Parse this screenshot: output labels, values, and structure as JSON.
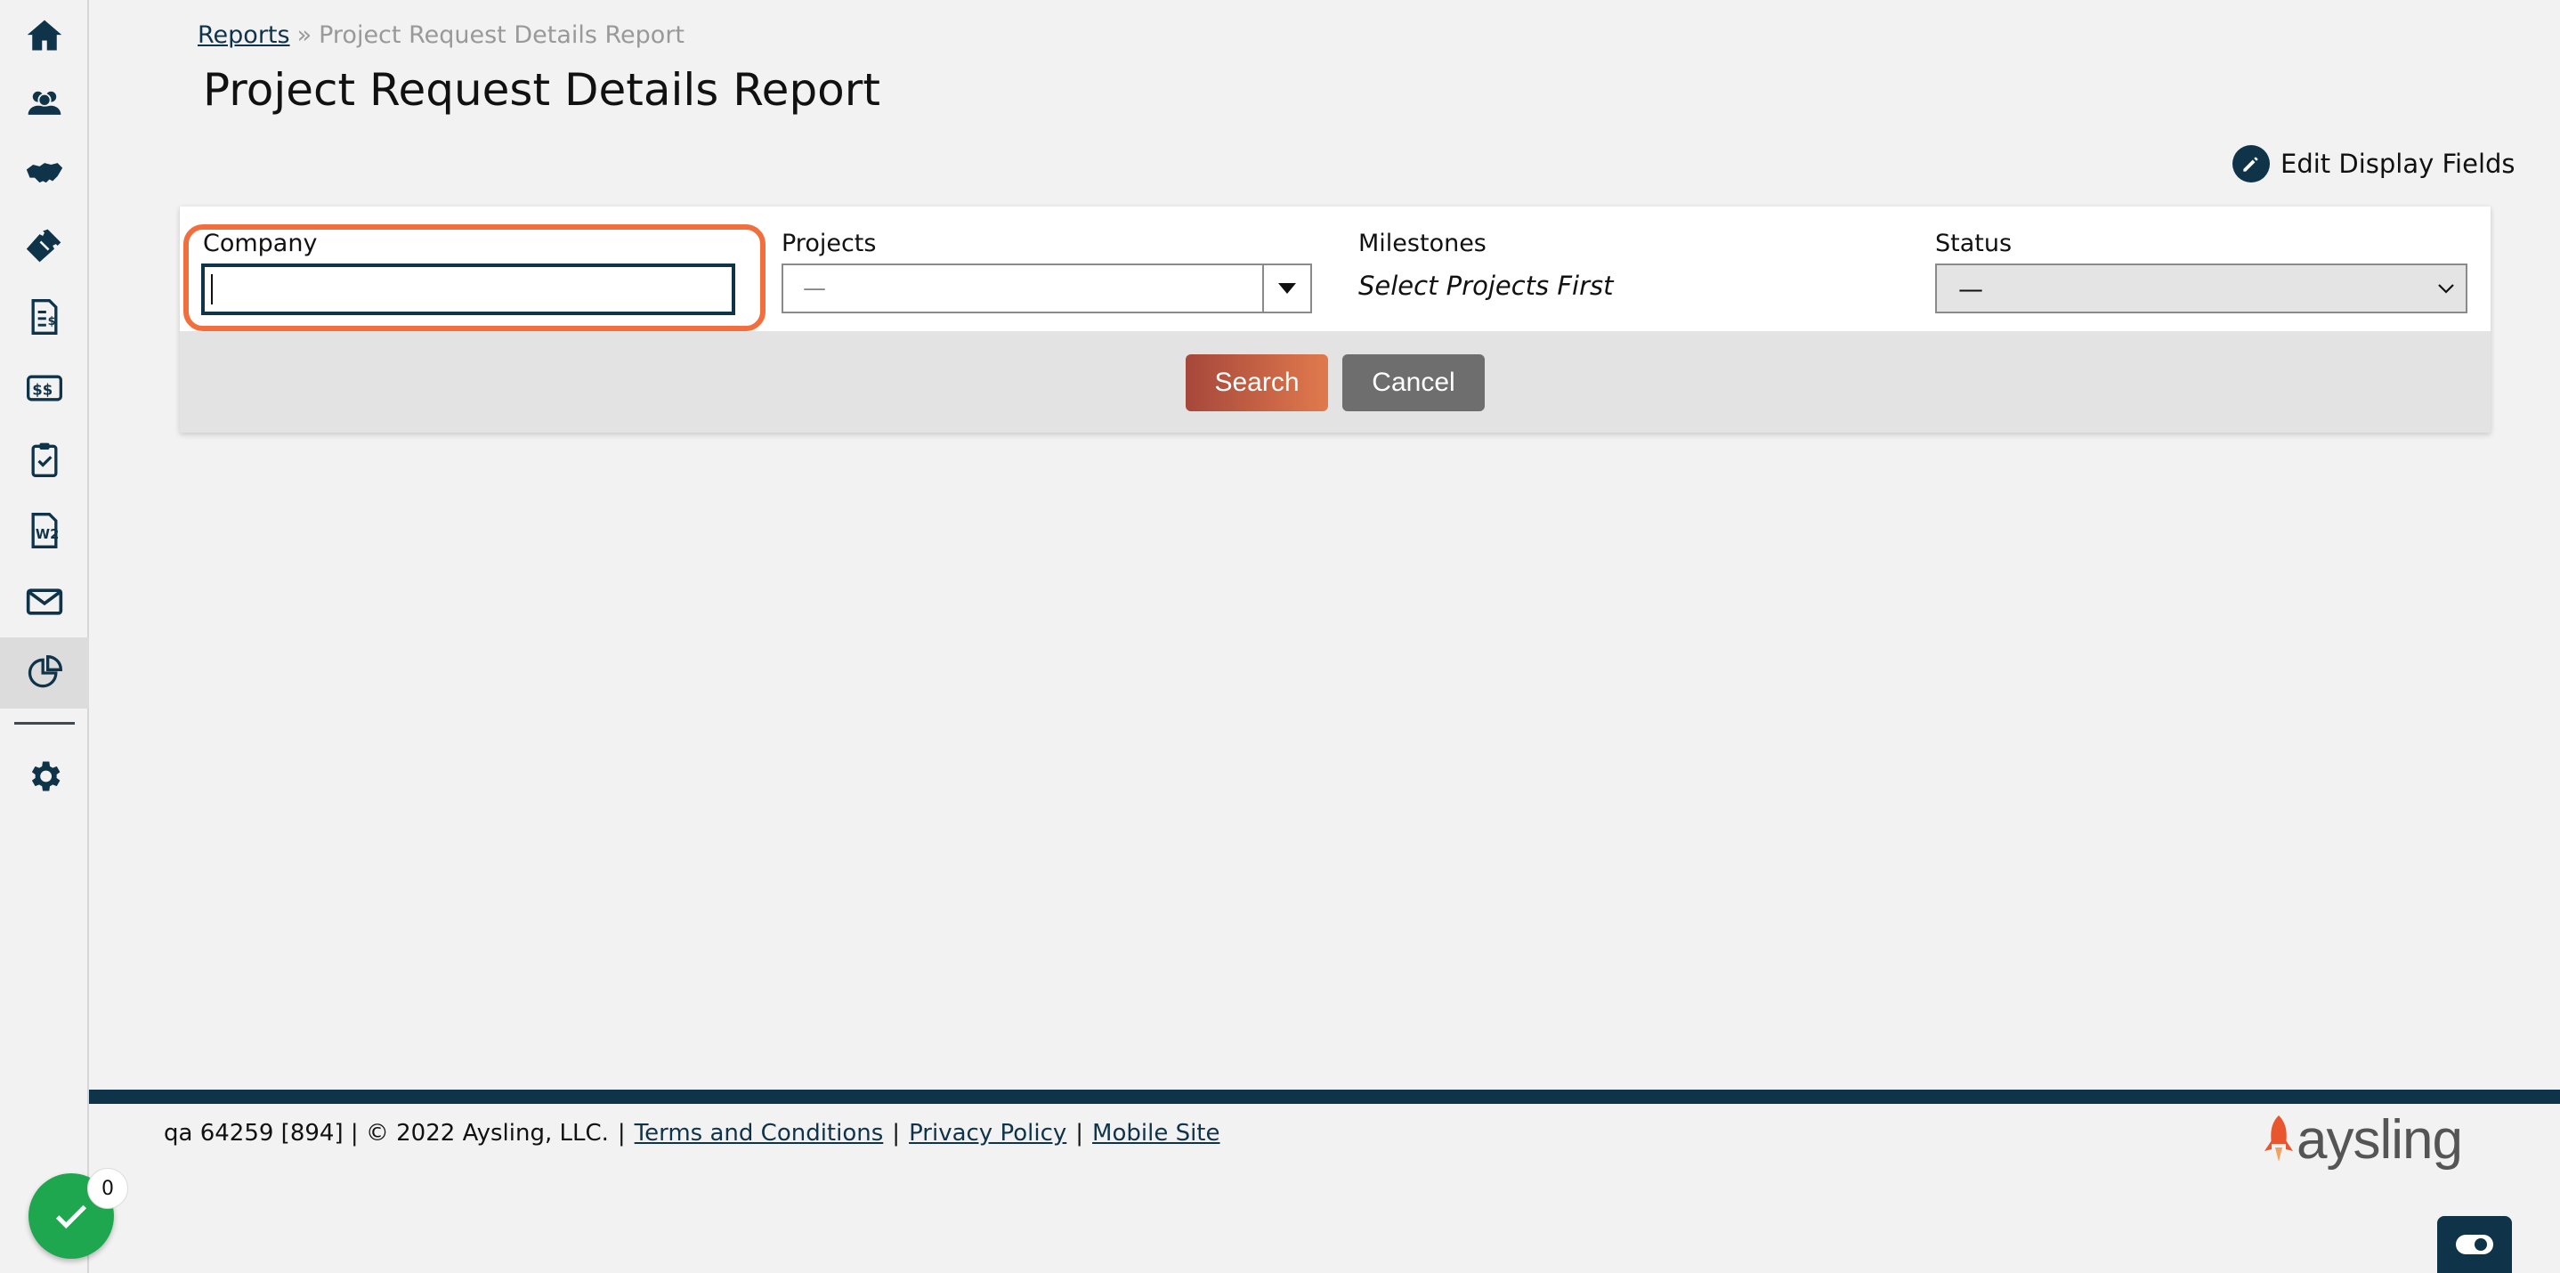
{
  "breadcrumb": {
    "parent": "Reports",
    "separator": "»",
    "current": "Project Request Details Report"
  },
  "page": {
    "title": "Project Request Details Report"
  },
  "toolbar": {
    "edit_fields_label": "Edit Display Fields"
  },
  "filters": {
    "company": {
      "label": "Company",
      "value": ""
    },
    "projects": {
      "label": "Projects",
      "value": "—"
    },
    "milestones": {
      "label": "Milestones",
      "hint": "Select Projects First"
    },
    "status": {
      "label": "Status",
      "value": "—"
    }
  },
  "actions": {
    "search_label": "Search",
    "cancel_label": "Cancel"
  },
  "footer": {
    "info": "qa 64259 [894] | © 2022 Aysling, LLC.",
    "terms": "Terms and Conditions",
    "privacy": "Privacy Policy",
    "mobile": "Mobile Site",
    "pipe": "|",
    "logo_text": "aysling"
  },
  "widgets": {
    "task_count": "0"
  },
  "colors": {
    "primary": "#0f3349",
    "highlight": "#f26f3d",
    "search_start": "#a6473b",
    "search_end": "#e07a4d",
    "cancel": "#6e6e6e",
    "fab": "#1fa74f",
    "logo_rocket": "#e8552e"
  },
  "sidebar": {
    "items": [
      {
        "icon": "home-icon"
      },
      {
        "icon": "users-icon"
      },
      {
        "icon": "handshake-icon"
      },
      {
        "icon": "ticket-icon"
      },
      {
        "icon": "invoice-icon"
      },
      {
        "icon": "money-icon"
      },
      {
        "icon": "clipboard-check-icon"
      },
      {
        "icon": "w2-form-icon"
      },
      {
        "icon": "mail-icon"
      },
      {
        "icon": "reports-icon"
      },
      {
        "icon": "gear-icon"
      }
    ]
  }
}
